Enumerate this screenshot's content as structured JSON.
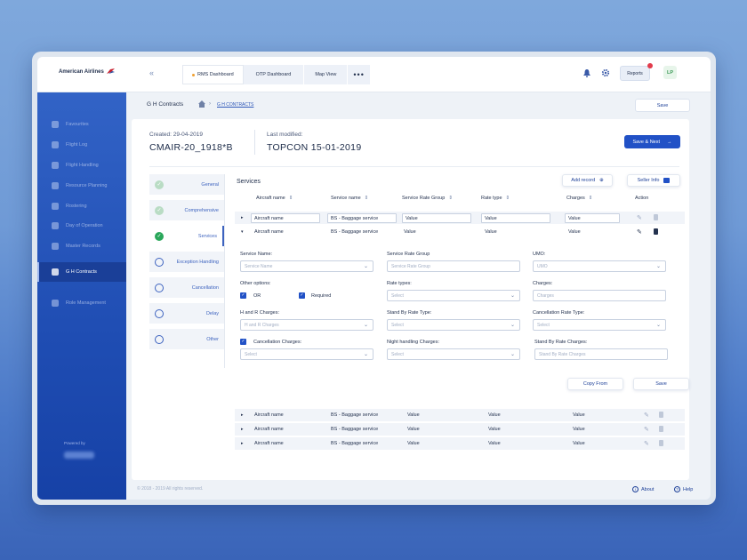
{
  "app": {
    "logo_text": "American Airlines",
    "collapse": "«",
    "brand_color": "#2151c6"
  },
  "tabs": [
    {
      "label": "RMS Dashboard"
    },
    {
      "label": "OTP Dashboard"
    },
    {
      "label": "Map View"
    },
    {
      "label": "•••"
    }
  ],
  "topbar": {
    "reports": "Reports",
    "avatar": "LP"
  },
  "sidebar": {
    "items": [
      {
        "label": "Favourites",
        "icon": "star-icon"
      },
      {
        "label": "Flight Log",
        "icon": "plane-icon"
      },
      {
        "label": "Flight Handling",
        "icon": "plane-handling-icon"
      },
      {
        "label": "Resource Planning",
        "icon": "people-icon"
      },
      {
        "label": "Rostering",
        "icon": "clipboard-icon"
      },
      {
        "label": "Day of Operation",
        "icon": "calendar-icon"
      },
      {
        "label": "Master Records",
        "icon": "list-icon"
      },
      {
        "label": "G H Contracts",
        "icon": "briefcase-icon"
      },
      {
        "label": "Role Management",
        "icon": "user-card-icon"
      }
    ],
    "powered": "Powered by"
  },
  "breadcrumb": {
    "title": "G H Contracts",
    "link": "G H CONTRACTS",
    "save": "Save"
  },
  "meta": {
    "created_label": "Created: 29-04-2019",
    "created_value": "CMAIR-20_1918*B",
    "modified_label": "Last modified:",
    "modified_value": "TOPCON 15-01-2019",
    "save_next": "Save & Next"
  },
  "steps": [
    {
      "label": "General",
      "state": "done"
    },
    {
      "label": "Comprehensive",
      "state": "done"
    },
    {
      "label": "Services",
      "state": "current"
    },
    {
      "label": "Exception Handling",
      "state": "todo"
    },
    {
      "label": "Cancellation",
      "state": "todo"
    },
    {
      "label": "Delay",
      "state": "todo"
    },
    {
      "label": "Other",
      "state": "todo"
    }
  ],
  "services": {
    "title": "Services",
    "add_record": "Add record",
    "seller_info": "Seller Info",
    "columns": [
      "Aircraft name",
      "Service name",
      "Service Rate Group",
      "Rate type",
      "Charges",
      "Action"
    ],
    "filter": {
      "aircraft": "Aircraft name",
      "service": "BS - Baggage service",
      "rate_group": "Value",
      "rate_type": "Value",
      "charges": "Value"
    },
    "rows": [
      {
        "aircraft": "Aircraft name",
        "service": "BS - Baggage service",
        "rate_group": "Value",
        "rate_type": "Value",
        "charges": "Value"
      },
      {
        "aircraft": "Aircraft name",
        "service": "BS - Baggage service",
        "rate_group": "Value",
        "rate_type": "Value",
        "charges": "Value"
      },
      {
        "aircraft": "Aircraft name",
        "service": "BS - Baggage service",
        "rate_group": "Value",
        "rate_type": "Value",
        "charges": "Value"
      },
      {
        "aircraft": "Aircraft name",
        "service": "BS - Baggage service",
        "rate_group": "Value",
        "rate_type": "Value",
        "charges": "Value"
      }
    ]
  },
  "form": {
    "service_name_label": "Service Name:",
    "service_name_ph": "Service Name",
    "rate_group_label": "Service Rate Group",
    "rate_group_ph": "Service Rate Group",
    "umo_label": "UMO:",
    "umo_ph": "UMO",
    "other_label": "Other options:",
    "or_label": "OR",
    "required_label": "Required",
    "rate_types_label": "Rate types:",
    "rate_types_ph": "Select",
    "charges_label": "Charges:",
    "charges_ph": "Charges",
    "hr_label": "H and R Charges:",
    "hr_ph": "H and R Charges",
    "standby_type_label": "Stand By Rate Type:",
    "standby_type_ph": "Select",
    "cancel_type_label": "Cancellation Rate Type:",
    "cancel_type_ph": "Select",
    "cancel_charges_label": "Cancellation Charges:",
    "cancel_charges_ph": "Select",
    "night_label": "Night handling Charges:",
    "night_ph": "Select",
    "standby_charges_label": "Stand By Rate Charges:",
    "standby_charges_ph": "Stand By Rate Charges",
    "copy_from": "Copy From",
    "save": "Save"
  },
  "footer": {
    "copyright": "© 2018 - 2019 All rights reserved.",
    "about": "About",
    "help": "Help"
  }
}
